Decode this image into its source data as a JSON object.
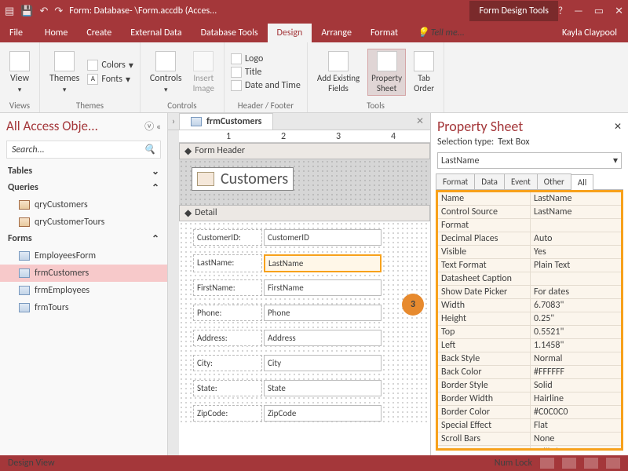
{
  "title": "Form: Database- \\Form.accdb (Acces...",
  "tools_context": "Form Design Tools",
  "user": "Kayla Claypool",
  "menu": {
    "file": "File",
    "home": "Home",
    "create": "Create",
    "external": "External Data",
    "dbtools": "Database Tools",
    "design": "Design",
    "arrange": "Arrange",
    "format": "Format",
    "tellme": "Tell me..."
  },
  "ribbon": {
    "views": {
      "label": "Views",
      "view": "View"
    },
    "themes": {
      "label": "Themes",
      "themes": "Themes",
      "colors": "Colors",
      "fonts": "Fonts"
    },
    "controls": {
      "label": "Controls",
      "controls": "Controls",
      "insert_image": "Insert\nImage"
    },
    "hf": {
      "label": "Header / Footer",
      "logo": "Logo",
      "title": "Title",
      "datetime": "Date and Time"
    },
    "tools": {
      "label": "Tools",
      "addfields": "Add Existing\nFields",
      "propsheet": "Property\nSheet",
      "taborder": "Tab\nOrder"
    }
  },
  "nav": {
    "header": "All Access Obje...",
    "search_placeholder": "Search...",
    "groups": [
      {
        "name": "Tables",
        "items": []
      },
      {
        "name": "Queries",
        "items": [
          "qryCustomers",
          "qryCustomerTours"
        ]
      },
      {
        "name": "Forms",
        "items": [
          "EmployeesForm",
          "frmCustomers",
          "frmEmployees",
          "frmTours"
        ]
      }
    ],
    "selected": "frmCustomers"
  },
  "doc_tab": "frmCustomers",
  "form": {
    "header_section": "Form Header",
    "detail_section": "Detail",
    "title": "Customers",
    "fields": [
      {
        "label": "CustomerID:",
        "control": "CustomerID"
      },
      {
        "label": "LastName:",
        "control": "LastName"
      },
      {
        "label": "FirstName:",
        "control": "FirstName"
      },
      {
        "label": "Phone:",
        "control": "Phone"
      },
      {
        "label": "Address:",
        "control": "Address"
      },
      {
        "label": "City:",
        "control": "City"
      },
      {
        "label": "State:",
        "control": "State"
      },
      {
        "label": "ZipCode:",
        "control": "ZipCode"
      }
    ],
    "selected_field": 1
  },
  "callout": "3",
  "prop": {
    "title": "Property Sheet",
    "seltype_lbl": "Selection type:",
    "seltype": "Text Box",
    "combo": "LastName",
    "tabs": [
      "Format",
      "Data",
      "Event",
      "Other",
      "All"
    ],
    "active_tab": 4,
    "rows": [
      {
        "k": "Name",
        "v": "LastName"
      },
      {
        "k": "Control Source",
        "v": "LastName"
      },
      {
        "k": "Format",
        "v": ""
      },
      {
        "k": "Decimal Places",
        "v": "Auto"
      },
      {
        "k": "Visible",
        "v": "Yes"
      },
      {
        "k": "Text Format",
        "v": "Plain Text"
      },
      {
        "k": "Datasheet Caption",
        "v": ""
      },
      {
        "k": "Show Date Picker",
        "v": "For dates"
      },
      {
        "k": "Width",
        "v": "6.7083\""
      },
      {
        "k": "Height",
        "v": "0.25\""
      },
      {
        "k": "Top",
        "v": "0.5521\""
      },
      {
        "k": "Left",
        "v": "1.1458\""
      },
      {
        "k": "Back Style",
        "v": "Normal"
      },
      {
        "k": "Back Color",
        "v": "#FFFFFF"
      },
      {
        "k": "Border Style",
        "v": "Solid"
      },
      {
        "k": "Border Width",
        "v": "Hairline"
      },
      {
        "k": "Border Color",
        "v": "#C0C0C0"
      },
      {
        "k": "Special Effect",
        "v": "Flat"
      },
      {
        "k": "Scroll Bars",
        "v": "None"
      },
      {
        "k": "Font Name",
        "v": "Calibri"
      }
    ]
  },
  "status": {
    "left": "Design View",
    "numlock": "Num Lock"
  }
}
